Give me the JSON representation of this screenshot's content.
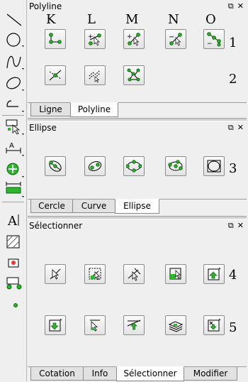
{
  "columns": [
    "K",
    "L",
    "M",
    "N",
    "O"
  ],
  "panels": {
    "polyline": {
      "title": "Polyline",
      "rows": [
        "1",
        "2"
      ],
      "tabs": [
        "Ligne",
        "Polyline"
      ],
      "active_tab": "Polyline"
    },
    "ellipse": {
      "title": "Ellipse",
      "rows": [
        "3"
      ],
      "tabs": [
        "Cercle",
        "Curve",
        "Ellipse"
      ],
      "active_tab": "Ellipse"
    },
    "selection": {
      "title": "Sélectionner",
      "rows": [
        "4",
        "5"
      ],
      "tabs": [
        "Cotation",
        "Info",
        "Sélectionner",
        "Modifier"
      ],
      "active_tab": "Sélectionner"
    }
  },
  "window_controls": {
    "float": "⧉",
    "close": "✕"
  },
  "toolbar_icons": [
    "line-tool-icon",
    "circle-tool-icon",
    "spline-tool-icon",
    "ellipse-tool-icon",
    "polyline-tool-icon",
    "select-tool-icon",
    "dimension-tool-icon",
    "snap-tool-icon",
    "measure-tool-icon",
    "text-tool-icon",
    "hatch-tool-icon",
    "image-tool-icon",
    "block-tool-icon",
    "point-tool-icon"
  ],
  "colors": {
    "accent_green": "#2db52d",
    "node_outline": "#0a6a0a"
  }
}
